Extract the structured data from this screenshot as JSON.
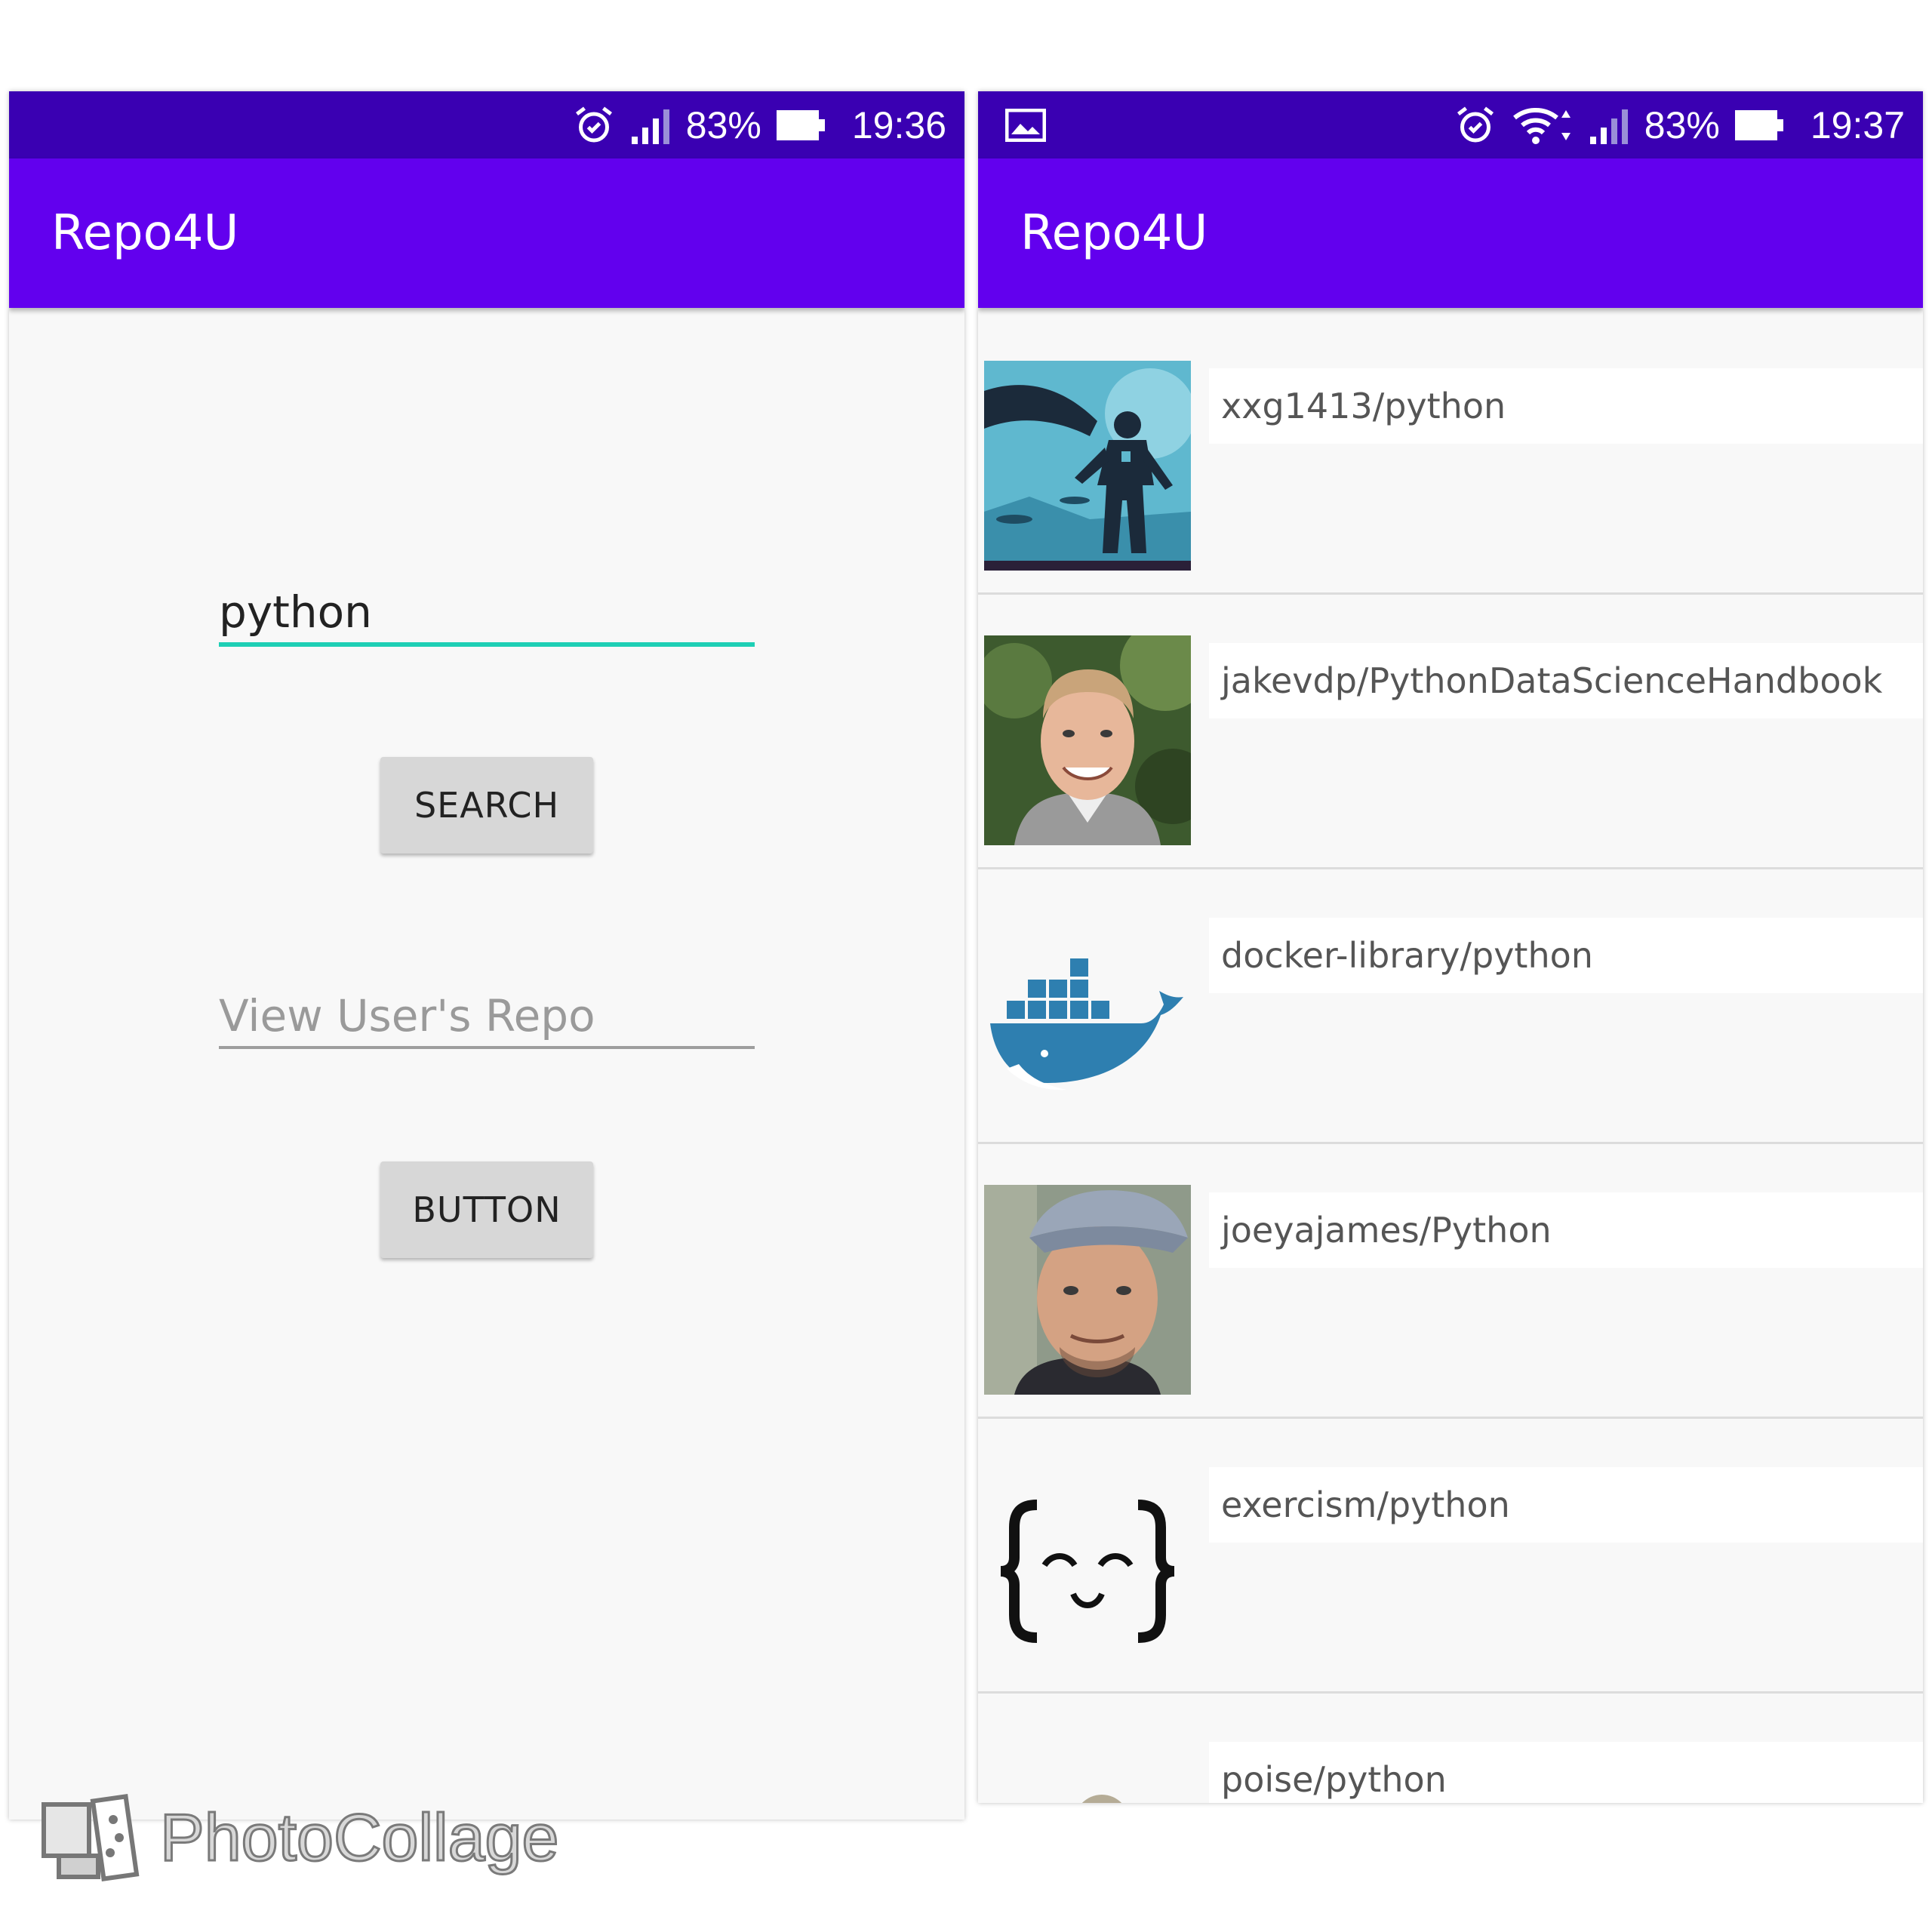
{
  "left_screen": {
    "status_bar": {
      "signal_percent": "83%",
      "time": "19:36"
    },
    "app_title": "Repo4U",
    "search_field_value": "python",
    "search_button_label": "SEARCH",
    "user_field_placeholder": "View User's Repo",
    "second_button_label": "BUTTON"
  },
  "right_screen": {
    "status_bar": {
      "signal_percent": "83%",
      "time": "19:37"
    },
    "app_title": "Repo4U",
    "repos": [
      {
        "name": "xxg1413/python",
        "avatar": "illustration-avatar"
      },
      {
        "name": "jakevdp/PythonDataScienceHandbook",
        "avatar": "person-photo-avatar"
      },
      {
        "name": "docker-library/python",
        "avatar": "docker-whale-avatar"
      },
      {
        "name": "joeyajames/Python",
        "avatar": "person-cap-photo-avatar"
      },
      {
        "name": "exercism/python",
        "avatar": "exercism-braces-avatar"
      },
      {
        "name": "poise/python",
        "avatar": "generic-avatar"
      }
    ]
  },
  "watermark": "PhotoCollage",
  "colors": {
    "status_bar": "#3a00b2",
    "app_bar": "#6200ee",
    "field_accent": "#1ecfb5",
    "background": "#f8f8f8"
  }
}
